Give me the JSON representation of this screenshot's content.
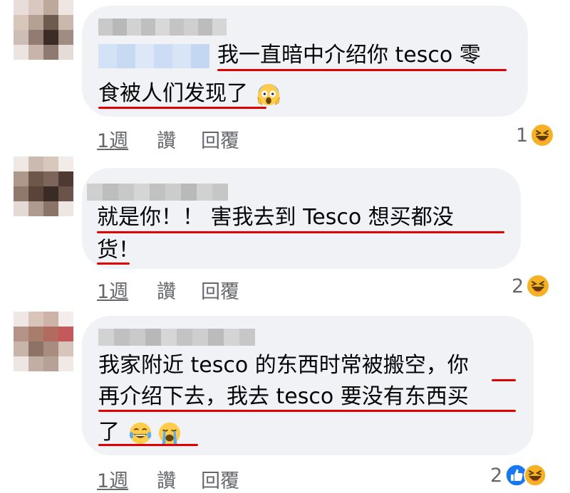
{
  "comments": [
    {
      "text_lines": [
        "我一直暗中介绍你 tesco 零",
        "食被人们发现了"
      ],
      "trailing_emoji": "scream-emoji",
      "actions": {
        "time": "1週",
        "like": "讚",
        "reply": "回覆"
      },
      "reaction_count": "1",
      "reaction_icons": [
        "laugh-reaction"
      ]
    },
    {
      "text_lines": [
        "就是你！！ 害我去到 Tesco 想买都没",
        "货！"
      ],
      "trailing_emoji": "",
      "actions": {
        "time": "1週",
        "like": "讚",
        "reply": "回覆"
      },
      "reaction_count": "2",
      "reaction_icons": [
        "laugh-reaction"
      ]
    },
    {
      "text_lines": [
        "我家附近 tesco 的东西时常被搬空，你",
        "再介绍下去，我去 tesco 要没有东西买",
        "了"
      ],
      "trailing_emoji": "joy-emoji sob-emoji",
      "actions": {
        "time": "1週",
        "like": "讚",
        "reply": "回覆"
      },
      "reaction_count": "2",
      "reaction_icons": [
        "like-reaction",
        "laugh-reaction"
      ]
    }
  ],
  "colors": {
    "bubble": "#f0f2f5",
    "underline": "#e00000",
    "meta_text": "#65676b",
    "like_blue": "#1877f2",
    "laugh_yellow": "#f7b125"
  }
}
